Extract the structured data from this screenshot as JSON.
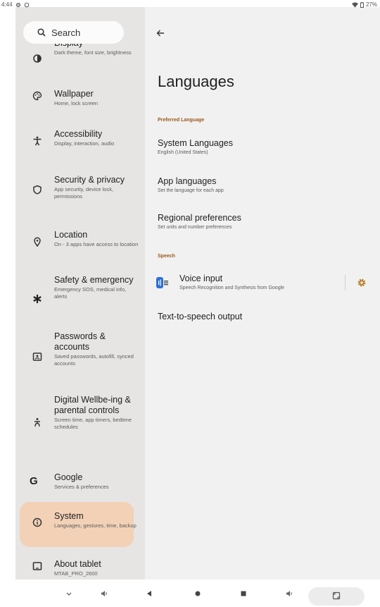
{
  "status_bar": {
    "time": "4:44",
    "battery": "27%"
  },
  "search": {
    "placeholder": "Search"
  },
  "sidebar": {
    "items": [
      {
        "title": "Display",
        "subtitle": "Dark theme, font size, brightness",
        "icon": "display-icon"
      },
      {
        "title": "Wallpaper",
        "subtitle": "Home, lock screen",
        "icon": "palette-icon"
      },
      {
        "title": "Accessibility",
        "subtitle": "Display, interaction, audio",
        "icon": "accessibility-icon"
      },
      {
        "title": "Security & privacy",
        "subtitle": "App security, device lock, permissions",
        "icon": "shield-icon"
      },
      {
        "title": "Location",
        "subtitle": "On - 3 apps have access to location",
        "icon": "location-pin-icon"
      },
      {
        "title": "Safety & emergency",
        "subtitle": "Emergency SOS, medical info, alerts",
        "icon": "asterisk-icon"
      },
      {
        "title": "Passwords & accounts",
        "subtitle": "Saved passwords, autofill, synced accounts",
        "icon": "badge-icon"
      },
      {
        "title": "Digital Wellbe-ing & parental controls",
        "subtitle": "Screen time, app timers, bedtime schedules",
        "icon": "wellbeing-icon"
      },
      {
        "title": "Google",
        "subtitle": "Services & preferences",
        "icon": "google-icon"
      },
      {
        "title": "System",
        "subtitle": "Languages, gestures, time, backup",
        "icon": "info-icon"
      },
      {
        "title": "About tablet",
        "subtitle": "MTAB_PRO_2600",
        "icon": "tablet-icon"
      }
    ]
  },
  "main": {
    "title": "Languages",
    "sections": [
      {
        "header": "Preferred Language",
        "items": [
          {
            "title": "System Languages",
            "subtitle": "English (United States)"
          },
          {
            "title": "App languages",
            "subtitle": "Set the language for each app"
          },
          {
            "title": "Regional preferences",
            "subtitle": "Set units and number preferences"
          }
        ]
      },
      {
        "header": "Speech",
        "items": [
          {
            "title": "Voice input",
            "subtitle": "Speech Recognition and Synthesis from Google"
          },
          {
            "title": "Text-to-speech output",
            "subtitle": ""
          }
        ]
      }
    ]
  },
  "colors": {
    "sidebar_bg": "#e6e5e4",
    "main_bg": "#f1f1f1",
    "selected_pill": "#f2d1b6",
    "section_header": "#9a5a1a",
    "accent_gear": "#b7791f"
  }
}
